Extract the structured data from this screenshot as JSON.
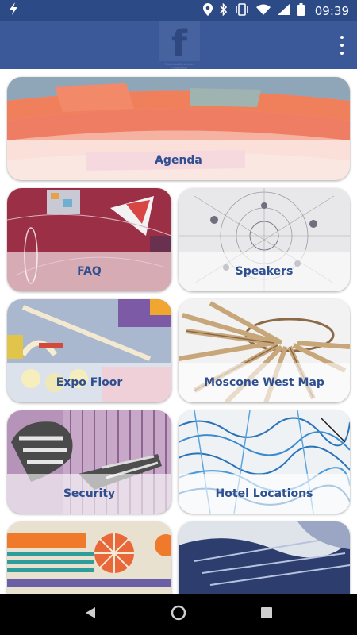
{
  "status_bar": {
    "time": "09:39",
    "icons": [
      "flash-icon",
      "location-icon",
      "bluetooth-icon",
      "vibrate-icon",
      "wifi-icon",
      "signal-icon",
      "battery-icon"
    ]
  },
  "app_bar": {
    "logo_letter": "f",
    "logo_caption": "Facebook Developer Conference",
    "icons": [
      "facebook-logo-icon",
      "overflow-menu-icon"
    ],
    "colors": {
      "status_bar": "#2c4a86",
      "app_bar": "#3b5998",
      "label": "#2f4f8f"
    }
  },
  "tiles": [
    {
      "label": "Agenda"
    },
    {
      "label": "FAQ"
    },
    {
      "label": "Speakers"
    },
    {
      "label": "Expo Floor"
    },
    {
      "label": "Moscone West Map"
    },
    {
      "label": "Security"
    },
    {
      "label": "Hotel Locations"
    }
  ],
  "nav_bar": {
    "icons": [
      "back-icon",
      "home-icon",
      "recents-icon"
    ]
  }
}
